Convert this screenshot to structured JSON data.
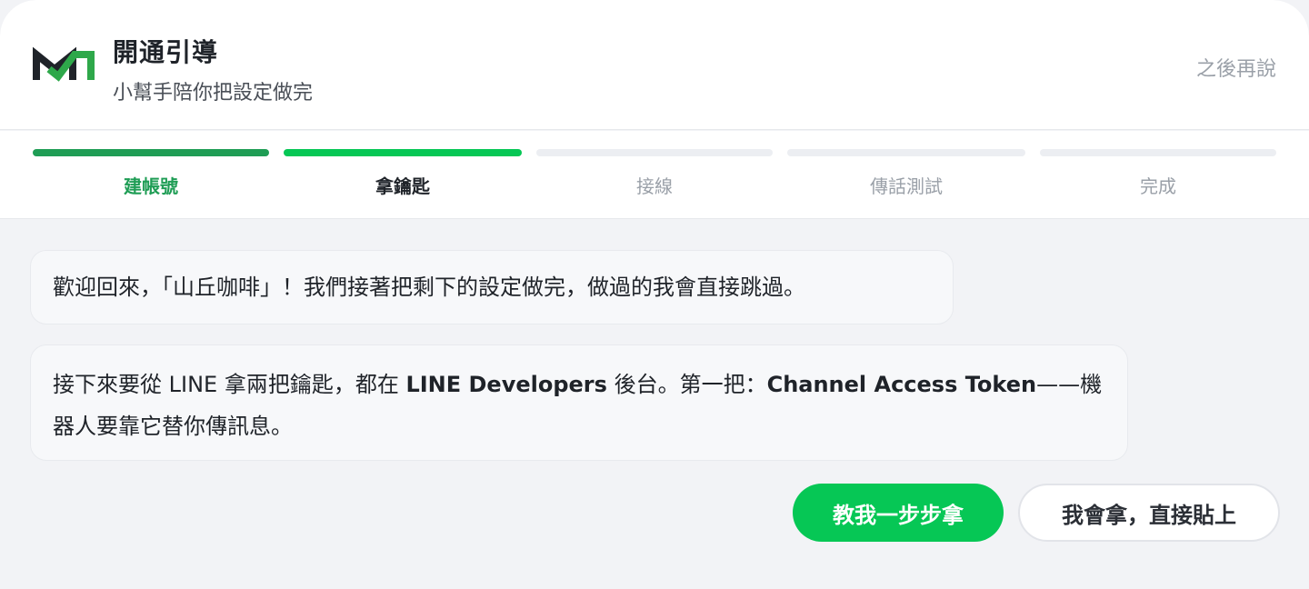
{
  "header": {
    "title": "開通引導",
    "subtitle": "小幫手陪你把設定做完",
    "later_label": "之後再說",
    "logo_colors": {
      "dark": "#1f2329",
      "accent": "#2ea84a"
    }
  },
  "stepper": {
    "steps": [
      {
        "label": "建帳號",
        "state": "done"
      },
      {
        "label": "拿鑰匙",
        "state": "active"
      },
      {
        "label": "接線",
        "state": "pending"
      },
      {
        "label": "傳話測試",
        "state": "pending"
      },
      {
        "label": "完成",
        "state": "pending"
      }
    ],
    "colors": {
      "done": "#1f9d55",
      "active": "#06c755",
      "pending": "#eceef2"
    }
  },
  "messages": {
    "m1": {
      "text": "歡迎回來，「山丘咖啡」！我們接著把剩下的設定做完，做過的我會直接跳過。"
    },
    "m2": {
      "t1": "接下來要從 LINE 拿兩把鑰匙，都在 ",
      "b1": "LINE Developers",
      "t2": " 後台。第一把：",
      "b2": "Channel Access Token",
      "t3": "——機器人要靠它替你傳訊息。"
    }
  },
  "actions": {
    "primary_label": "教我一步步拿",
    "secondary_label": "我會拿，直接貼上"
  }
}
